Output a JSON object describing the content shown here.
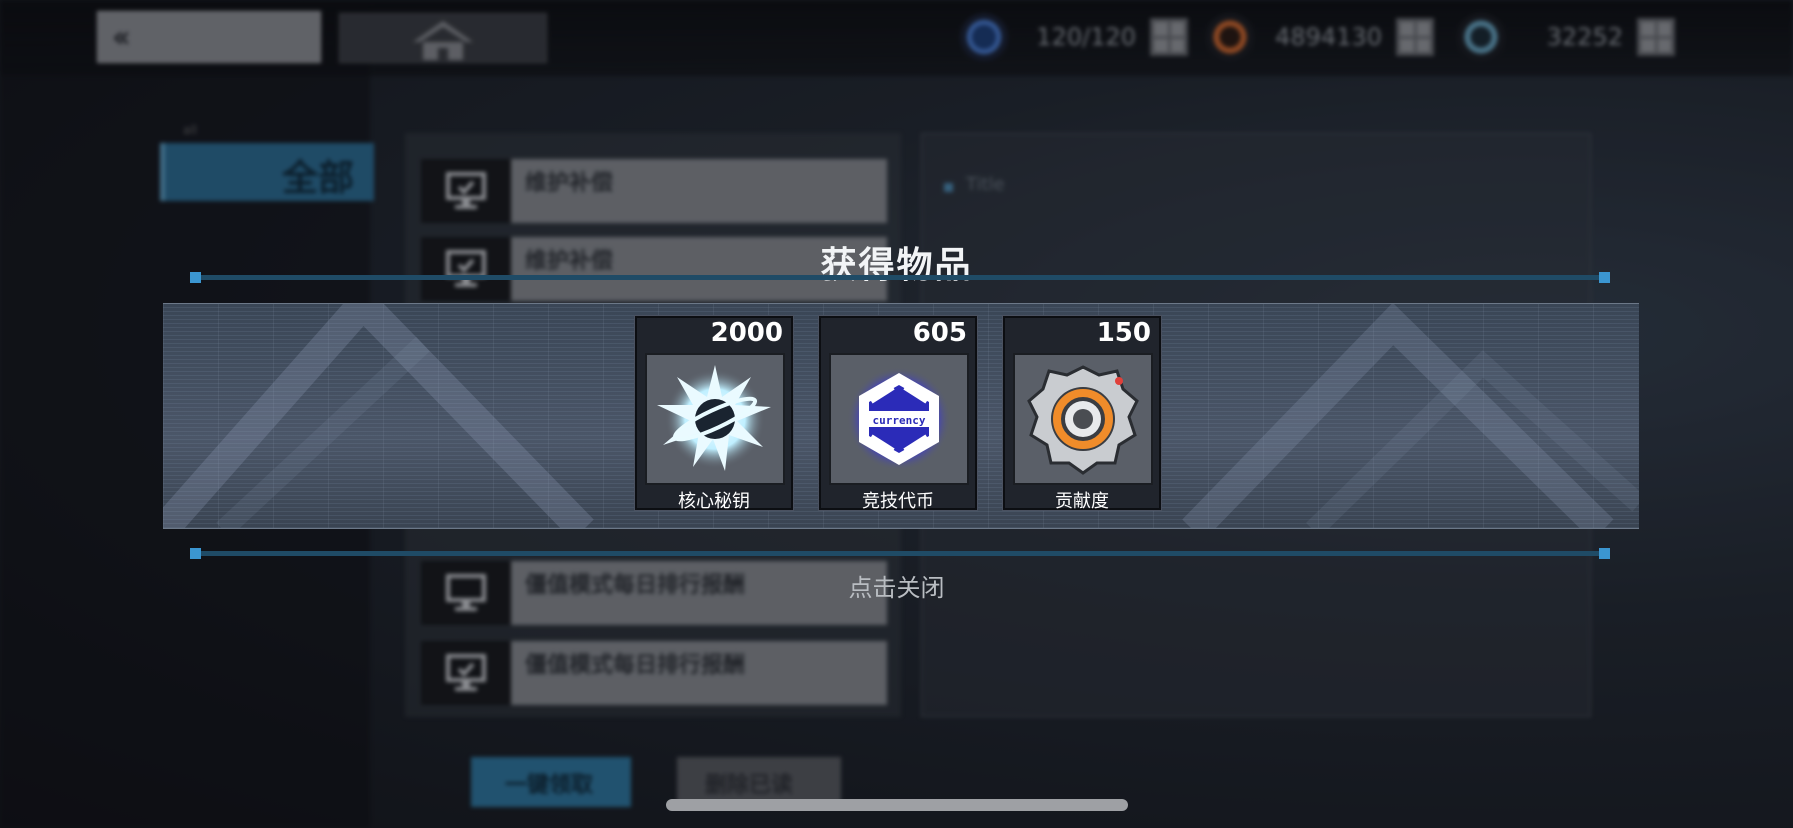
{
  "topbar": {
    "resources": [
      {
        "icon": "plus-circle-icon",
        "value": "120/120",
        "color": "#4a7fd6"
      },
      {
        "icon": "gear-orange-icon",
        "value": "4894130",
        "color": "#d2692e"
      },
      {
        "icon": "gear-cyan-icon",
        "value": "32252",
        "color": "#6aa9c6"
      }
    ]
  },
  "sidebar": {
    "tab_small": "all",
    "tab_all": "全部"
  },
  "mail_list": [
    {
      "title": "维护补偿"
    },
    {
      "title": "维护补偿"
    },
    {
      "title": "僵值模式每日排行报酬"
    },
    {
      "title": "僵值模式每日排行报酬"
    }
  ],
  "detail": {
    "title": "Title"
  },
  "bottom": {
    "claim_all": "一键领取",
    "delete_read": "删除已读"
  },
  "reward_popup": {
    "title": "获得物品",
    "close_hint": "点击关闭",
    "items": [
      {
        "name": "核心秘钥",
        "count": "2000",
        "icon": "core-key-icon"
      },
      {
        "name": "竞技代币",
        "count": "605",
        "icon": "arena-currency-icon",
        "icon_text": "currency"
      },
      {
        "name": "贡献度",
        "count": "150",
        "icon": "contribution-gear-icon"
      }
    ]
  }
}
